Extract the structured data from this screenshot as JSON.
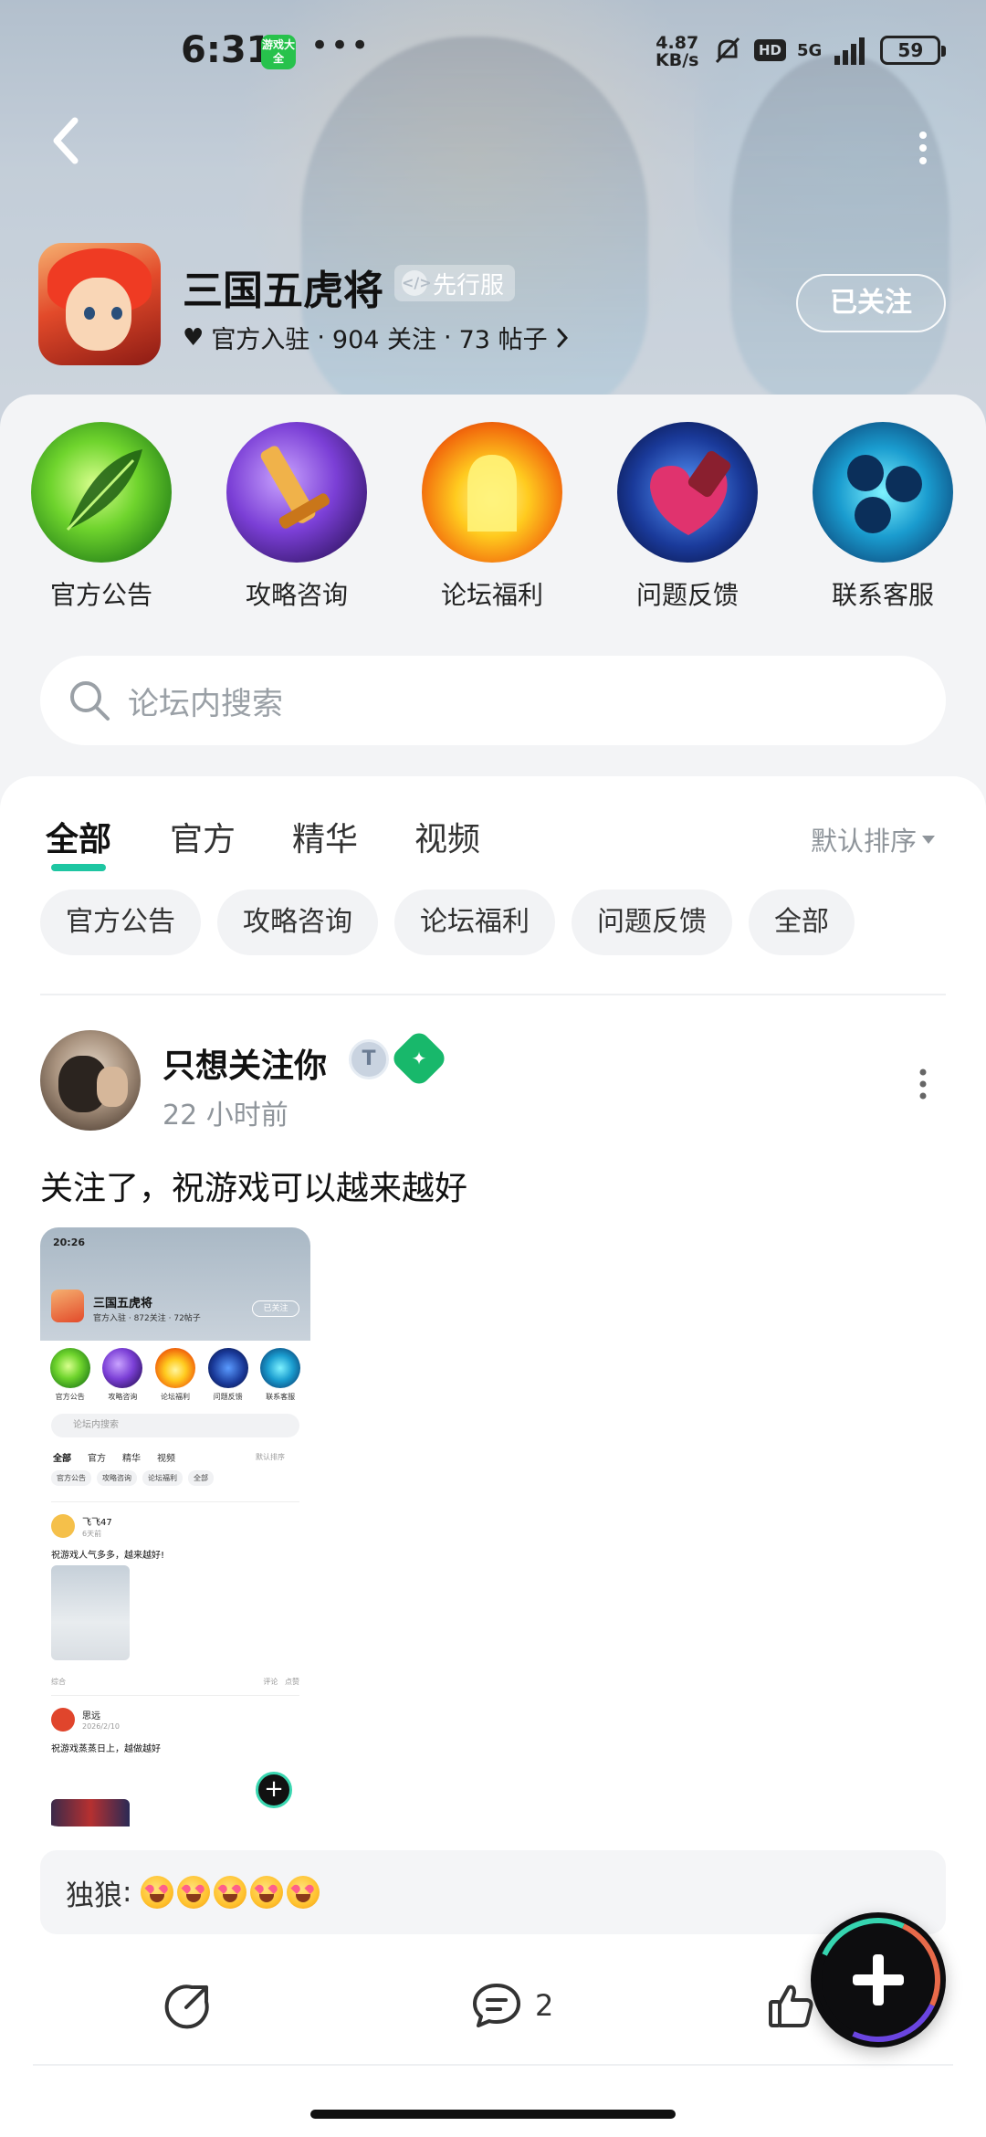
{
  "status_bar": {
    "time": "6:31",
    "app_badge": "游戏大全",
    "dots": "•••",
    "net_speed_value": "4.87",
    "net_speed_unit": "KB/s",
    "hd": "HD",
    "network": "5G",
    "battery": "59"
  },
  "header": {
    "game_title": "三国五虎将",
    "pre_badge": "先行服",
    "meta_official": "官方入驻",
    "meta_follows": "904 关注",
    "meta_posts": "73 帖子",
    "meta_sep": "·",
    "follow_button": "已关注"
  },
  "quick_entries": [
    {
      "label": "官方公告",
      "icon": "leaf-icon"
    },
    {
      "label": "攻略咨询",
      "icon": "sword-icon"
    },
    {
      "label": "论坛福利",
      "icon": "fire-icon"
    },
    {
      "label": "问题反馈",
      "icon": "heart-shield-icon"
    },
    {
      "label": "联系客服",
      "icon": "orbs-icon"
    }
  ],
  "search": {
    "placeholder": "论坛内搜索"
  },
  "tabs": [
    {
      "label": "全部",
      "active": true
    },
    {
      "label": "官方",
      "active": false
    },
    {
      "label": "精华",
      "active": false
    },
    {
      "label": "视频",
      "active": false
    }
  ],
  "sort_label": "默认排序",
  "chips": [
    "官方公告",
    "攻略咨询",
    "论坛福利",
    "问题反馈",
    "全部"
  ],
  "post": {
    "username": "只想关注你",
    "time": "22 小时前",
    "text": "关注了，祝游戏可以越来越好",
    "comment_user": "独狼",
    "comment_colon": ":",
    "comment_emojis": 5,
    "comment_count": "2"
  },
  "thumbnail": {
    "status_time": "20:26",
    "title": "三国五虎将",
    "meta": "官方入驻 · 872关注 · 72帖子",
    "follow": "已关注",
    "quick": [
      "官方公告",
      "攻略咨询",
      "论坛福利",
      "问题反馈",
      "联系客服"
    ],
    "search": "论坛内搜索",
    "tabs": [
      "全部",
      "官方",
      "精华",
      "视频"
    ],
    "sort": "默认排序",
    "chips": [
      "官方公告",
      "攻略咨询",
      "论坛福利",
      "全部"
    ],
    "post1_name": "飞飞47",
    "post1_date": "6天前",
    "post1_text": "祝游戏人气多多，越来越好!",
    "post1_foot_left": "综合",
    "post1_foot_comment": "评论",
    "post1_foot_like": "点赞",
    "post2_name": "思远",
    "post2_date": "2026/2/10",
    "post2_text": "祝游戏蒸蒸日上，越做越好"
  },
  "colors": {
    "accent": "#1ec6a2",
    "badge_green": "#18b86b",
    "muted_text": "#8f959b"
  }
}
